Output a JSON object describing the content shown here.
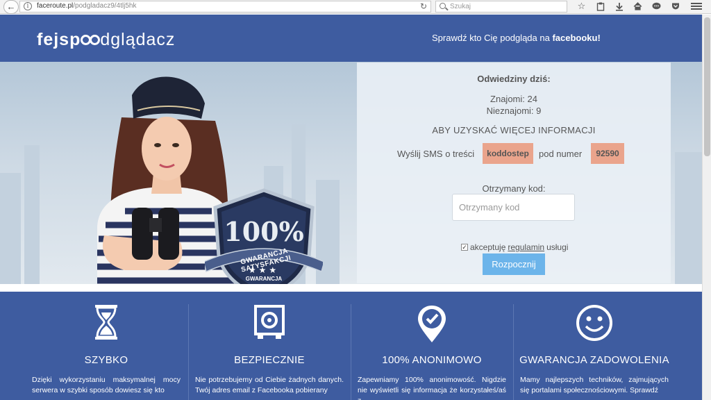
{
  "browser": {
    "url_host": "faceroute.pl",
    "url_path": "/podgladacz9/4tlj5hk",
    "search_placeholder": "Szukaj"
  },
  "header": {
    "logo_part1": "fejsp",
    "logo_part2": "dglądacz",
    "tagline_text": "Sprawdź kto Cię podgląda na ",
    "tagline_bold": "facebooku!"
  },
  "badge": {
    "percent": "100%",
    "ribbon": "GWARANCJA SATYSFAKCJI",
    "stars": "★★★",
    "sub": "GWARANCJA"
  },
  "form": {
    "visits_title": "Odwiedziny dziś:",
    "friends": "Znajomi: 24",
    "strangers": "Nieznajomi: 9",
    "info_heading": "ABY UZYSKAĆ WIĘCEJ INFORMACJI",
    "sms_prefix": "Wyślij SMS o treści",
    "sms_code": "koddostep",
    "sms_middle": "pod numer",
    "sms_number": "92590",
    "code_label": "Otrzymany kod:",
    "code_placeholder": "Otrzymany kod",
    "terms_prefix": "akceptuję",
    "terms_link": "regulamin",
    "terms_suffix": "usługi",
    "start_label": "Rozpocznij"
  },
  "features": [
    {
      "title": "SZYBKO",
      "text": "Dzięki wykorzystaniu maksymalnej mocy serwera w szybki sposób dowiesz się kto"
    },
    {
      "title": "BEZPIECZNIE",
      "text": "Nie potrzebujemy od Ciebie żadnych danych. Twój adres email z Facebooka pobierany"
    },
    {
      "title": "100% ANONIMOWO",
      "text": "Zapewniamy 100% anonimowość. Nigdzie nie wyświetli się informacja że korzystałeś/aś z"
    },
    {
      "title": "GWARANCJA ZADOWOLENIA",
      "text": "Mamy najlepszych techników, zajmujących się portalami społecznościowymi. Sprawdź"
    }
  ]
}
